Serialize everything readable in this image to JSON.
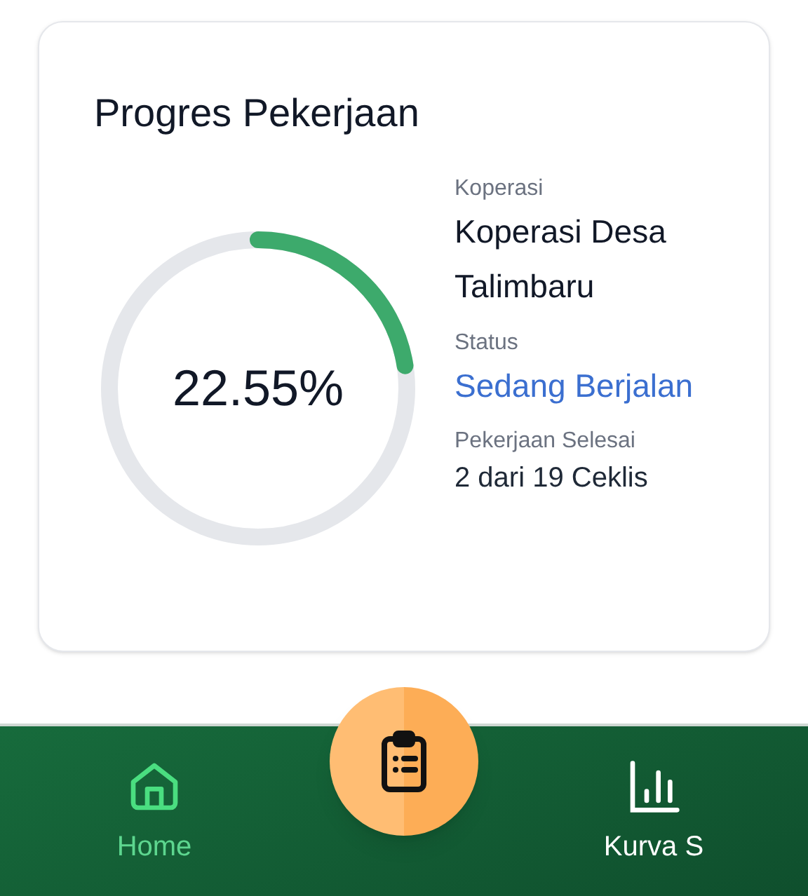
{
  "card": {
    "title": "Progres Pekerjaan",
    "progress": {
      "level": 0.2255,
      "reading": "22.55%"
    },
    "fields": [
      {
        "label": "Koperasi",
        "value": "Koperasi Desa Talimbaru",
        "kind": "plain"
      },
      {
        "label": "Status",
        "value": "Sedang Berjalan",
        "kind": "status"
      },
      {
        "label": "Pekerjaan Selesai",
        "value": "2 dari 19 Ceklis",
        "kind": "small"
      }
    ]
  },
  "bottom_nav": {
    "items": [
      {
        "label": "Home",
        "selected": true,
        "kind": "home"
      },
      {
        "label": "Kurva S",
        "selected": false,
        "kind": "chart"
      }
    ]
  }
}
